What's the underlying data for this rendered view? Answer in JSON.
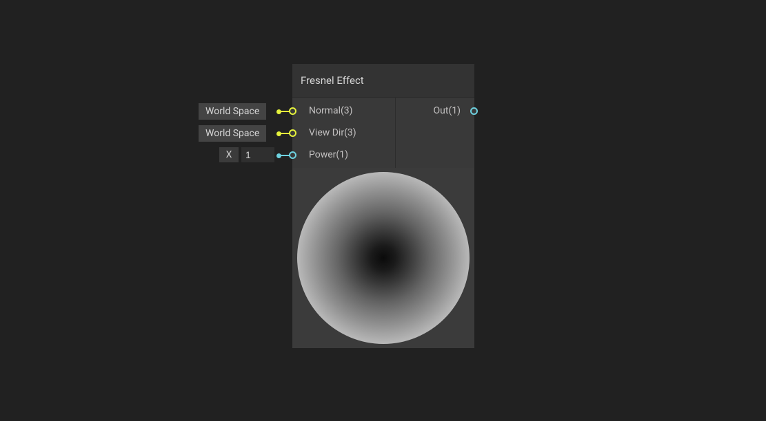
{
  "node": {
    "title": "Fresnel Effect",
    "inputs": [
      {
        "label": "Normal(3)"
      },
      {
        "label": "View Dir(3)"
      },
      {
        "label": "Power(1)"
      }
    ],
    "outputs": [
      {
        "label": "Out(1)"
      }
    ]
  },
  "externals": {
    "normal_chip": "World Space",
    "viewdir_chip": "World Space",
    "power_x_label": "X",
    "power_x_value": "1"
  }
}
